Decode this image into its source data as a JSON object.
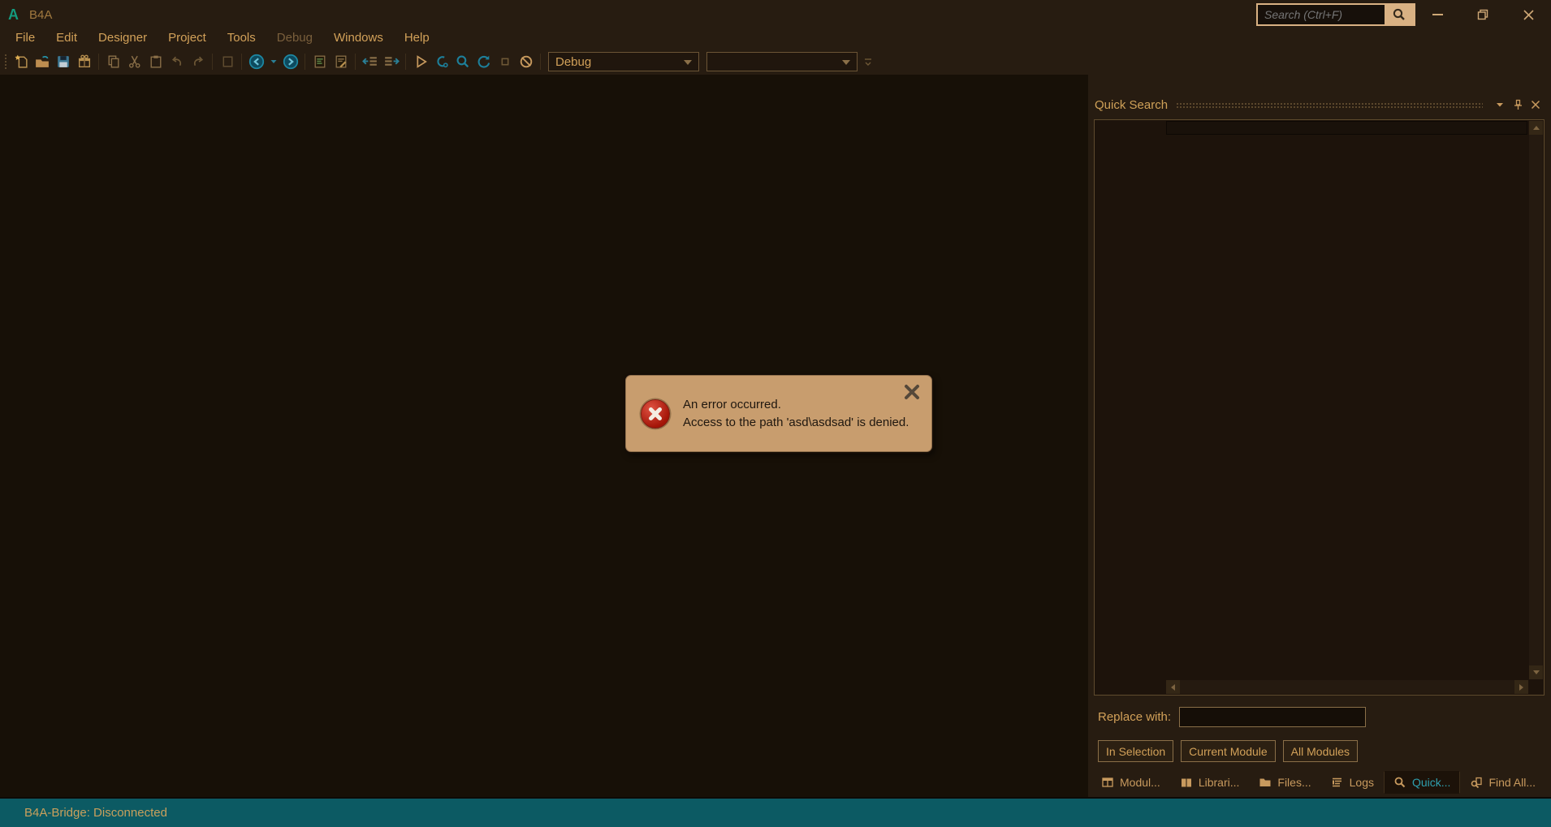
{
  "window": {
    "logo": "A",
    "title": "B4A",
    "search_placeholder": "Search (Ctrl+F)"
  },
  "menubar": {
    "items": [
      {
        "label": "File",
        "enabled": true
      },
      {
        "label": "Edit",
        "enabled": true
      },
      {
        "label": "Designer",
        "enabled": true
      },
      {
        "label": "Project",
        "enabled": true
      },
      {
        "label": "Tools",
        "enabled": true
      },
      {
        "label": "Debug",
        "enabled": false
      },
      {
        "label": "Windows",
        "enabled": true
      },
      {
        "label": "Help",
        "enabled": true
      }
    ]
  },
  "toolbar": {
    "build_configuration": "Debug",
    "module_selector": "",
    "icons": [
      "new-project",
      "open-project",
      "save-all",
      "package",
      "copy",
      "cut",
      "paste",
      "undo",
      "redo",
      "designer-grid",
      "navigate-back",
      "back-history-dropdown",
      "navigate-forward",
      "comment-selection",
      "uncomment-selection",
      "outdent",
      "indent",
      "run",
      "connect-device",
      "debug",
      "resume",
      "stop",
      "clean-project",
      "toolbar-overflow"
    ]
  },
  "quick_search_panel": {
    "title": "Quick Search",
    "search_value": "",
    "replace_label": "Replace with:",
    "replace_value": "",
    "scope_buttons": [
      "In Selection",
      "Current Module",
      "All Modules"
    ]
  },
  "bottom_tabs": [
    {
      "label": "Modul...",
      "icon": "modules-icon",
      "active": false
    },
    {
      "label": "Librari...",
      "icon": "libraries-icon",
      "active": false
    },
    {
      "label": "Files...",
      "icon": "files-icon",
      "active": false
    },
    {
      "label": "Logs",
      "icon": "logs-icon",
      "active": false
    },
    {
      "label": "Quick...",
      "icon": "quick-search-icon",
      "active": true
    },
    {
      "label": "Find All...",
      "icon": "find-all-icon",
      "active": false
    }
  ],
  "error_dialog": {
    "line1": "An error occurred.",
    "line2": "Access to the path 'asd\\asdsad' is denied."
  },
  "statusbar": {
    "text": "B4A-Bridge: Disconnected"
  },
  "colors": {
    "chrome_bg": "#271c11",
    "editor_bg": "#171007",
    "accent_teal_logo": "#149a7e",
    "tan_text": "#d2a159",
    "status_bar_teal": "#0c5a63",
    "dialog_bg": "#c89d6e",
    "error_red": "#b1200f",
    "active_tab_text": "#2f9fae",
    "search_border_tan": "#d9b183"
  }
}
